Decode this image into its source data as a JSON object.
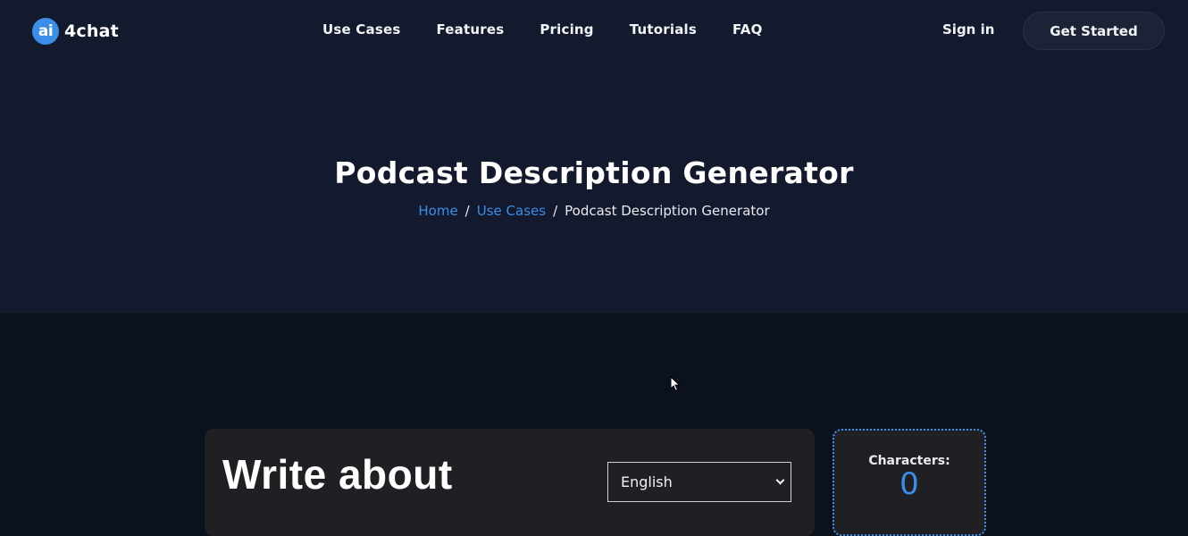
{
  "header": {
    "logo_badge": "ai",
    "logo_text": "4chat",
    "nav": [
      {
        "label": "Use Cases"
      },
      {
        "label": "Features"
      },
      {
        "label": "Pricing"
      },
      {
        "label": "Tutorials"
      },
      {
        "label": "FAQ"
      }
    ],
    "sign_in_label": "Sign in",
    "get_started_label": "Get Started"
  },
  "hero": {
    "title": "Podcast Description Generator",
    "breadcrumb": [
      {
        "label": "Home",
        "link": true
      },
      {
        "label": "Use Cases",
        "link": true
      },
      {
        "label": "Podcast Description Generator",
        "link": false
      }
    ],
    "separator": "/"
  },
  "editor": {
    "heading": "Write about",
    "language_select": {
      "selected": "English"
    }
  },
  "counter": {
    "label": "Characters:",
    "value": "0"
  },
  "colors": {
    "accent": "#3b8ee8",
    "hero_bg": "#131a2e",
    "page_bg": "#0c111e",
    "card_bg": "#201f24"
  }
}
